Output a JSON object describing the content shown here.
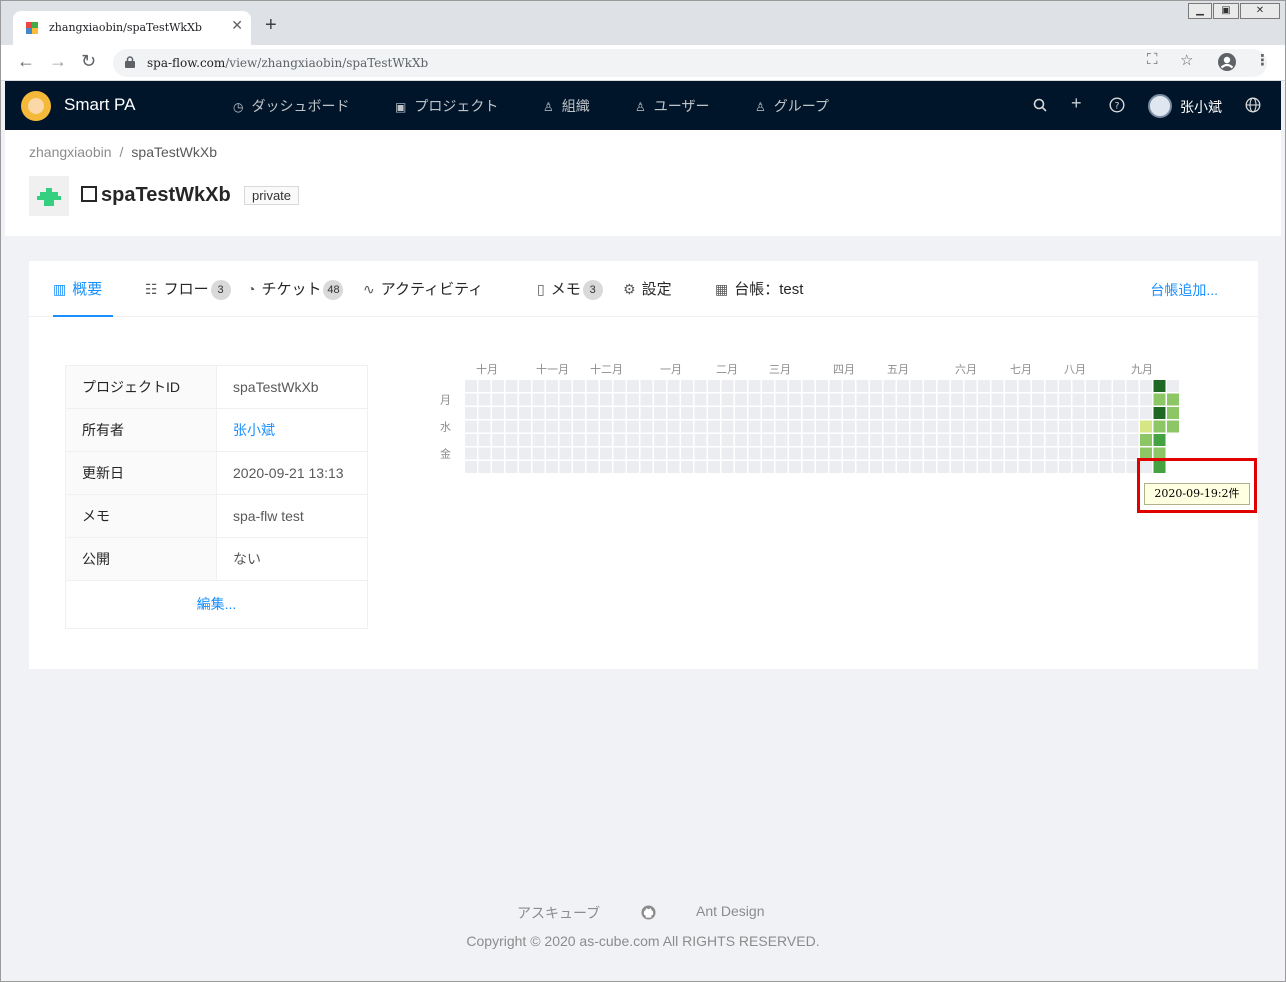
{
  "browser": {
    "tab_title": "zhangxiaobin/spaTestWkXb",
    "url_host": "spa-flow.com",
    "url_path": "/view/zhangxiaobin/spaTestWkXb"
  },
  "appbar": {
    "brand": "Smart PA",
    "nav": [
      {
        "label": "ダッシュボード",
        "icon": "dashboard-icon"
      },
      {
        "label": "プロジェクト",
        "icon": "project-icon"
      },
      {
        "label": "組織",
        "icon": "team-icon"
      },
      {
        "label": "ユーザー",
        "icon": "user-icon"
      },
      {
        "label": "グループ",
        "icon": "group-icon"
      }
    ],
    "user_name": "张小斌"
  },
  "breadcrumb": [
    "zhangxiaobin",
    "spaTestWkXb"
  ],
  "project": {
    "title": "spaTestWkXb",
    "visibility_tag": "private"
  },
  "tabs": [
    {
      "label": "概要",
      "icon": "chart-icon",
      "count": null
    },
    {
      "label": "フロー",
      "icon": "flow-icon",
      "count": "3"
    },
    {
      "label": "チケット",
      "icon": "ticket-icon",
      "count": "48"
    },
    {
      "label": "アクティビティ",
      "icon": "activity-icon",
      "count": null
    },
    {
      "label": "メモ",
      "icon": "memo-icon",
      "count": "3"
    },
    {
      "label": "設定",
      "icon": "gear-icon",
      "count": null
    },
    {
      "label": "台帳：test",
      "icon": "table-icon",
      "count": null
    }
  ],
  "add_ledger": "台帳追加...",
  "info": {
    "rows": [
      {
        "label": "プロジェクトID",
        "value": "spaTestWkXb"
      },
      {
        "label": "所有者",
        "value": "张小斌"
      },
      {
        "label": "更新日",
        "value": "2020-09-21 13:13"
      },
      {
        "label": "メモ",
        "value": "spa-flw test"
      },
      {
        "label": "公開",
        "value": "ない"
      }
    ],
    "edit": "編集..."
  },
  "heatmap": {
    "months": [
      "十月",
      "十一月",
      "十二月",
      "一月",
      "二月",
      "三月",
      "四月",
      "五月",
      "六月",
      "七月",
      "八月",
      "九月"
    ],
    "weekdays": [
      "月",
      "水",
      "金"
    ],
    "weeks": 53,
    "empty_color": "#ebedf0",
    "activity": [
      {
        "week": 50,
        "day": 3,
        "level": 1
      },
      {
        "week": 50,
        "day": 4,
        "level": 2
      },
      {
        "week": 50,
        "day": 5,
        "level": 2
      },
      {
        "week": 51,
        "day": 0,
        "level": 4
      },
      {
        "week": 51,
        "day": 1,
        "level": 2
      },
      {
        "week": 51,
        "day": 2,
        "level": 4
      },
      {
        "week": 51,
        "day": 3,
        "level": 2
      },
      {
        "week": 51,
        "day": 4,
        "level": 3
      },
      {
        "week": 51,
        "day": 5,
        "level": 2
      },
      {
        "week": 51,
        "day": 6,
        "level": 3
      },
      {
        "week": 52,
        "day": 1,
        "level": 2
      },
      {
        "week": 52,
        "day": 2,
        "level": 2
      },
      {
        "week": 52,
        "day": 3,
        "level": 2
      },
      {
        "week": 52,
        "day": 4,
        "level": 1
      },
      {
        "week": 52,
        "day": 5,
        "level": 4
      },
      {
        "week": 52,
        "day": 6,
        "level": 2
      }
    ],
    "levels": [
      "#ebedf0",
      "#d6e685",
      "#8cc665",
      "#44a340",
      "#1e6823"
    ],
    "tooltip": "2020-09-19:2件"
  },
  "footer": {
    "links": [
      "アスキューブ",
      "Ant Design"
    ],
    "copyright": "Copyright © 2020 as-cube.com All RIGHTS RESERVED."
  }
}
